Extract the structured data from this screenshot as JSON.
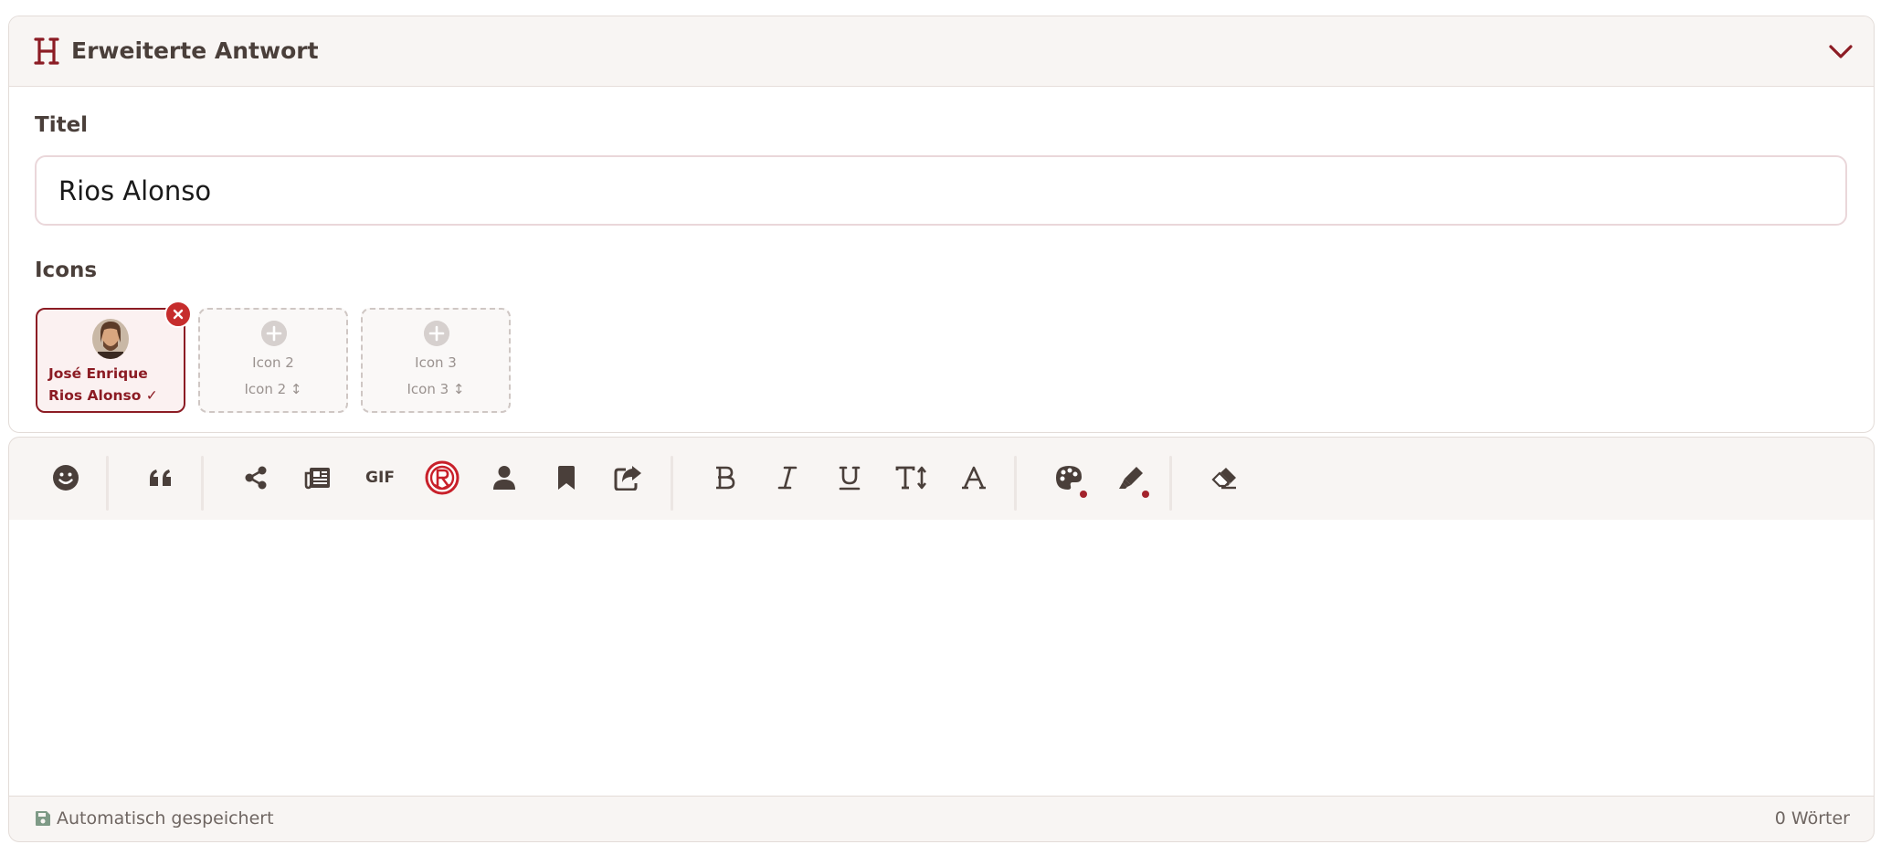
{
  "panel": {
    "title": "Erweiterte Antwort",
    "header_icon": "heading-icon",
    "toggle_icon": "chevron-down-icon"
  },
  "title_field": {
    "label": "Titel",
    "value": "Rios Alonso"
  },
  "icons_section": {
    "label": "Icons",
    "slots": [
      {
        "name": "José Enrique Rios Alonso ✓",
        "filled": true
      },
      {
        "label": "Icon 2",
        "sub_label": "Icon 2 ↕",
        "filled": false
      },
      {
        "label": "Icon 3",
        "sub_label": "Icon 3 ↕",
        "filled": false
      }
    ]
  },
  "toolbar": {
    "items": [
      "smiley-icon",
      "quote-icon",
      "share-icon",
      "newspaper-icon",
      "gif-button",
      "club-logo-icon",
      "user-icon",
      "bookmark-icon",
      "share-square-icon",
      "bold-icon",
      "italic-icon",
      "underline-icon",
      "text-height-icon",
      "font-icon",
      "palette-icon",
      "highlighter-icon",
      "eraser-icon"
    ],
    "gif_label": "GIF"
  },
  "footer": {
    "save_status": "Automatisch gespeichert",
    "word_count": "0 Wörter"
  },
  "colors": {
    "accent": "#8c1c24",
    "remove": "#c62d2d",
    "text": "#4a3f3a",
    "header_bg": "#f8f5f3"
  }
}
